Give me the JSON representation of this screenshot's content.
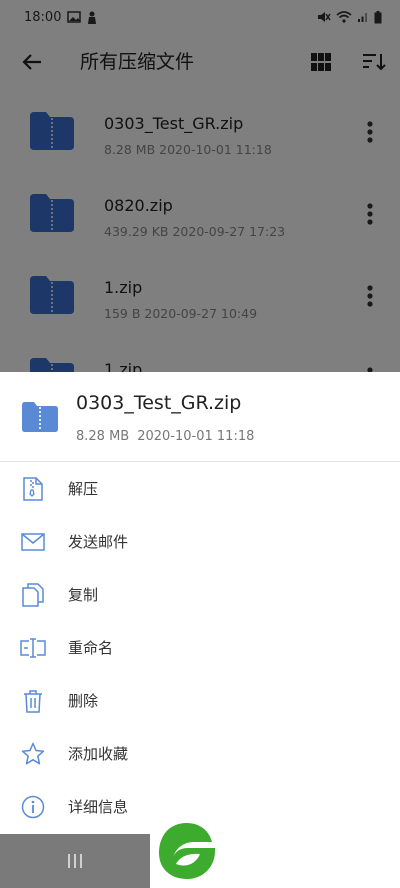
{
  "status_bar": {
    "time": "18:00"
  },
  "app_bar": {
    "title": "所有压缩文件"
  },
  "files": [
    {
      "name": "0303_Test_GR.zip",
      "meta": "8.28 MB 2020-10-01 11:18"
    },
    {
      "name": "0820.zip",
      "meta": "439.29 KB 2020-09-27 17:23"
    },
    {
      "name": "1.zip",
      "meta": "159 B 2020-09-27 10:49"
    },
    {
      "name": "1.zip",
      "meta": ""
    }
  ],
  "sheet": {
    "title": "0303_Test_GR.zip",
    "size": "8.28 MB",
    "date": "2020-10-01 11:18",
    "actions": [
      {
        "label": "解压",
        "icon": "zip-file-icon"
      },
      {
        "label": "发送邮件",
        "icon": "mail-icon"
      },
      {
        "label": "复制",
        "icon": "copy-icon"
      },
      {
        "label": "重命名",
        "icon": "rename-icon"
      },
      {
        "label": "删除",
        "icon": "trash-icon"
      },
      {
        "label": "添加收藏",
        "icon": "star-icon"
      },
      {
        "label": "详细信息",
        "icon": "info-icon"
      }
    ]
  },
  "colors": {
    "folder_blue": "#3b6fd1",
    "icon_blue": "#5a8ad6",
    "brand_green": "#3cab2e"
  }
}
